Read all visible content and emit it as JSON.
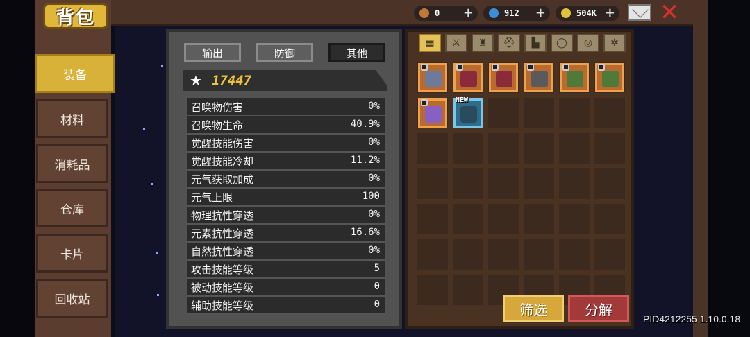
{
  "header": {
    "title": "背包",
    "resources": [
      {
        "icon": "energy-icon",
        "value": "0",
        "color": "#c0783a"
      },
      {
        "icon": "gem-icon",
        "value": "912",
        "color": "#3b8fd6"
      },
      {
        "icon": "gold-coin-icon",
        "value": "504K",
        "color": "#e2c23b"
      }
    ],
    "plus_label": "+"
  },
  "sidebar": {
    "items": [
      {
        "label": "装备",
        "active": true
      },
      {
        "label": "材料",
        "active": false
      },
      {
        "label": "消耗品",
        "active": false
      },
      {
        "label": "仓库",
        "active": false
      },
      {
        "label": "卡片",
        "active": false
      },
      {
        "label": "回收站",
        "active": false
      }
    ]
  },
  "stats": {
    "tabs": [
      {
        "label": "输出",
        "active": false
      },
      {
        "label": "防御",
        "active": false
      },
      {
        "label": "其他",
        "active": true
      }
    ],
    "score": "17447",
    "rows": [
      {
        "label": "召唤物伤害",
        "value": "0%"
      },
      {
        "label": "召唤物生命",
        "value": "40.9%"
      },
      {
        "label": "觉醒技能伤害",
        "value": "0%"
      },
      {
        "label": "觉醒技能冷却",
        "value": "11.2%"
      },
      {
        "label": "元气获取加成",
        "value": "0%"
      },
      {
        "label": "元气上限",
        "value": "100"
      },
      {
        "label": "物理抗性穿透",
        "value": "0%"
      },
      {
        "label": "元素抗性穿透",
        "value": "16.6%"
      },
      {
        "label": "自然抗性穿透",
        "value": "0%"
      },
      {
        "label": "攻击技能等级",
        "value": "5"
      },
      {
        "label": "被动技能等级",
        "value": "0"
      },
      {
        "label": "辅助技能等级",
        "value": "0"
      }
    ]
  },
  "inventory": {
    "filters": [
      {
        "icon": "grid-icon",
        "active": true
      },
      {
        "icon": "sword-icon",
        "active": false
      },
      {
        "icon": "armor-icon",
        "active": false
      },
      {
        "icon": "helmet-icon",
        "active": false
      },
      {
        "icon": "boots-icon",
        "active": false
      },
      {
        "icon": "ring-icon",
        "active": false
      },
      {
        "icon": "amulet-icon",
        "active": false
      },
      {
        "icon": "gear-icon",
        "active": false
      }
    ],
    "items": [
      {
        "icon": "gauntlet-icon",
        "locked": true,
        "new": false,
        "color": "#6d7a9a"
      },
      {
        "icon": "armor-icon",
        "locked": true,
        "new": false,
        "color": "#8b2a3a"
      },
      {
        "icon": "armor-icon",
        "locked": true,
        "new": false,
        "color": "#8b2a3a"
      },
      {
        "icon": "gauntlet-icon",
        "locked": true,
        "new": false,
        "color": "#5a5a5a"
      },
      {
        "icon": "boots-icon",
        "locked": true,
        "new": false,
        "color": "#4f7a3a"
      },
      {
        "icon": "boots-icon",
        "locked": true,
        "new": false,
        "color": "#4f7a3a"
      },
      {
        "icon": "ring-icon",
        "locked": true,
        "new": false,
        "color": "#8a5fc4"
      },
      {
        "icon": "amulet-icon",
        "locked": false,
        "new": true,
        "color": "#2a4a5e"
      }
    ],
    "new_label": "NEW",
    "filter_button": "筛选",
    "decompose_button": "分解"
  },
  "footer": {
    "pid": "PID4212255 1.10.0.18"
  }
}
